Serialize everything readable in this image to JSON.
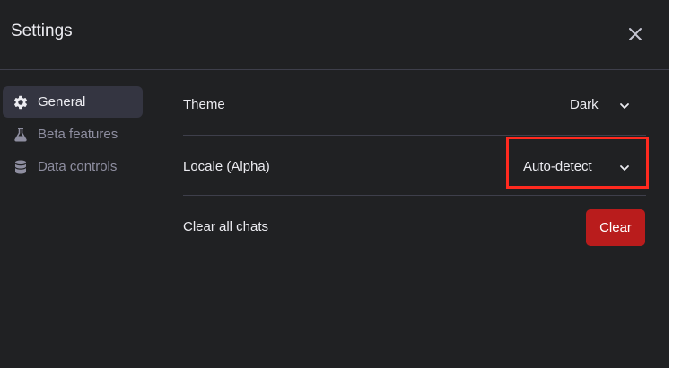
{
  "dialog": {
    "title": "Settings",
    "close_icon": "close-icon"
  },
  "sidebar": {
    "items": [
      {
        "label": "General",
        "icon": "gear-icon",
        "active": true
      },
      {
        "label": "Beta features",
        "icon": "flask-icon",
        "active": false
      },
      {
        "label": "Data controls",
        "icon": "database-icon",
        "active": false
      }
    ]
  },
  "settings": {
    "theme": {
      "label": "Theme",
      "value": "Dark"
    },
    "locale": {
      "label": "Locale (Alpha)",
      "value": "Auto-detect"
    },
    "clear_chats": {
      "label": "Clear all chats",
      "button_label": "Clear"
    }
  },
  "colors": {
    "dialog_bg": "#202123",
    "active_item_bg": "#343541",
    "danger": "#b91c1c",
    "highlight": "#ff2a1f"
  }
}
